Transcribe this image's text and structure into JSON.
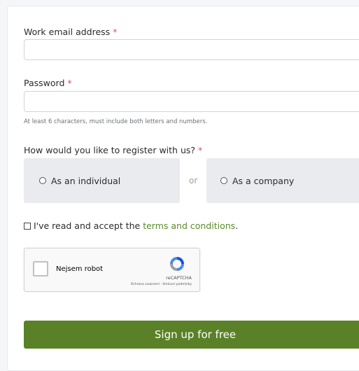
{
  "form": {
    "email_label": "Work email address",
    "email_value": "",
    "email_placeholder": "",
    "password_label": "Password",
    "password_value": "",
    "password_placeholder": "",
    "password_hint": "At least 6 characters, must include both letters and numbers.",
    "required_marker": "*",
    "register_question": "How would you like to register with us?",
    "option_individual": "As an individual",
    "option_separator": "or",
    "option_company": "As a company",
    "terms_prefix": "I've read and accept the",
    "terms_link": "terms and conditions",
    "terms_suffix": ".",
    "submit_label": "Sign up for free"
  },
  "captcha": {
    "label": "Nejsem robot",
    "brand": "reCAPTCHA",
    "links": "Ochrana soukromí - Smluvní podmínky"
  },
  "colors": {
    "accent": "#5a8127",
    "link": "#5b8a2b",
    "required": "#e25050",
    "option_bg": "#e9ebee"
  },
  "icons": {
    "captcha_logo": "recaptcha-icon"
  }
}
